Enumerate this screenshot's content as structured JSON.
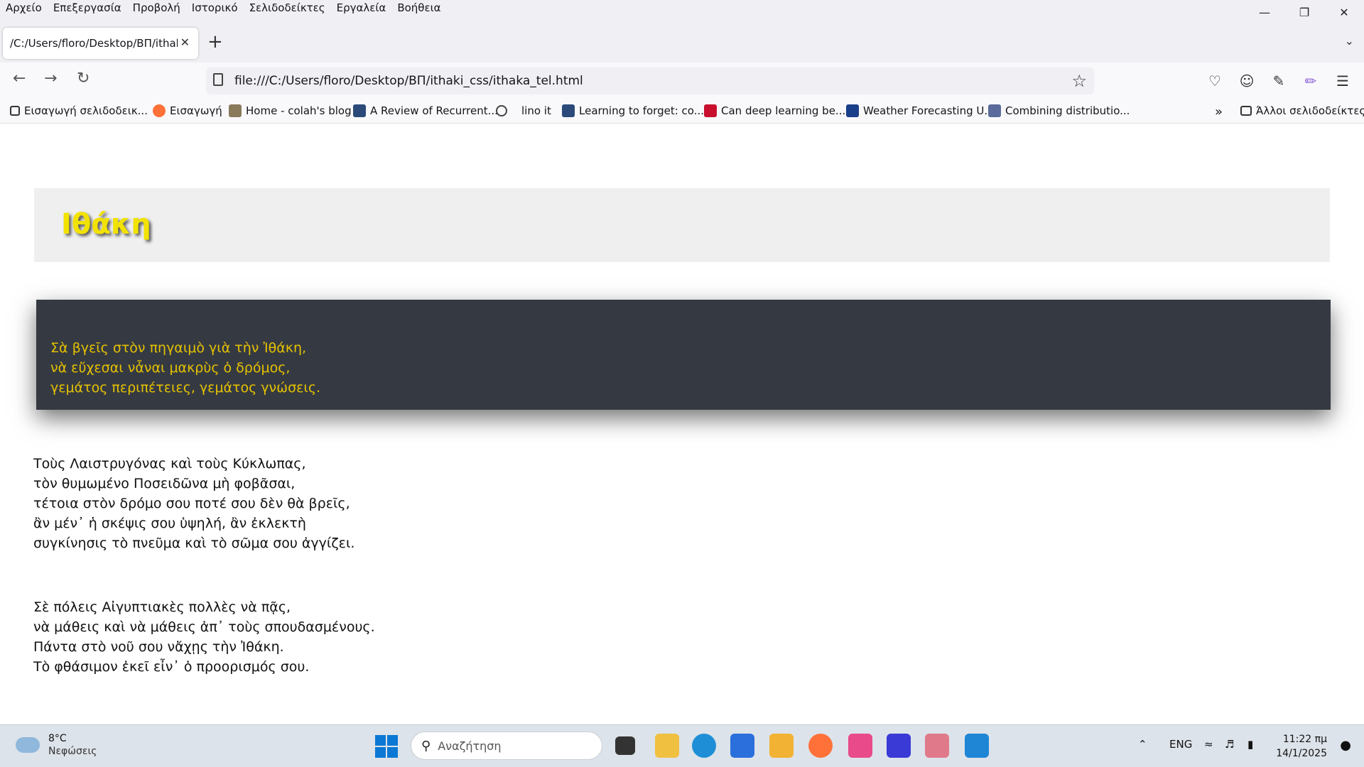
{
  "menu": [
    "Αρχείο",
    "Επεξεργασία",
    "Προβολή",
    "Ιστορικό",
    "Σελιδοδείκτες",
    "Εργαλεία",
    "Βοήθεια"
  ],
  "tab": {
    "title": "/C:/Users/floro/Desktop/ΒΠ/ithaki_c"
  },
  "url": "file:///C:/Users/floro/Desktop/ΒΠ/ithaki_css/ithaka_tel.html",
  "bookmarks": [
    "Εισαγωγή σελιδοδεικ...",
    "Εισαγωγή",
    "Home - colah's blog",
    "A Review of Recurrent...",
    "lino it",
    "Learning to forget: co...",
    "Can deep learning be...",
    "Weather Forecasting U...",
    "Combining distributio..."
  ],
  "other_bookmarks": "Άλλοι σελιδοδείκτες",
  "page": {
    "heading": "Ιθάκη",
    "intro": [
      "Σὰ βγεῖς στὸν πηγαιμὸ γιὰ τὴν Ἰθάκη,",
      "νὰ εὔχεσαι νἆναι μακρὺς ὁ δρόμος,",
      "γεμάτος περιπέτειες, γεμάτος γνώσεις."
    ],
    "stanza1": [
      "Τοὺς Λαιστρυγόνας καὶ τοὺς Κύκλωπας,",
      "τὸν θυμωμένο Ποσειδῶνα μὴ φοβᾶσαι,",
      "τέτοια στὸν δρόμο σου ποτέ σου δὲν θὰ βρεῖς,",
      "ἂν μέν᾽ ἡ σκέψις σου ὑψηλή, ἂν ἐκλεκτὴ",
      "συγκίνησις τὸ πνεῦμα καὶ τὸ σῶμα σου ἀγγίζει."
    ],
    "stanza2": [
      "Σὲ πόλεις Αἰγυπτιακὲς πολλὲς νὰ πᾷς,",
      "νὰ μάθεις καὶ νὰ μάθεις ἀπ᾽ τοὺς σπουδασμένους.",
      "Πάντα στὸ νοῦ σου νἄχῃς τὴν Ἰθάκη.",
      "Τὸ φθάσιμον ἐκεῖ εἶν᾽ ὁ προορισμός σου."
    ]
  },
  "taskbar": {
    "temp": "8°C",
    "weather": "Νεφώσεις",
    "search_placeholder": "Αναζήτηση",
    "lang": "ENG",
    "time": "11:22 πμ",
    "date": "14/1/2025"
  },
  "colors": {
    "heading": "#f2e200",
    "verse": "#e6c200",
    "dark_box": "#353a42",
    "header_box": "#efefef"
  }
}
